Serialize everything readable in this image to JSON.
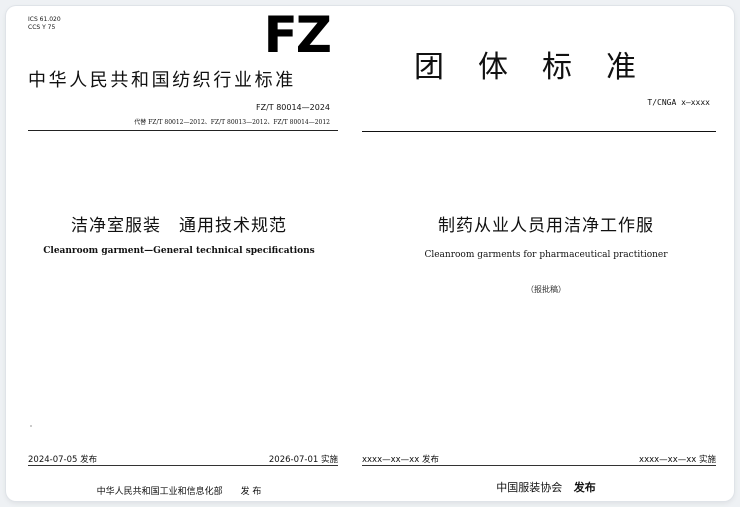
{
  "left_doc": {
    "ics": "ICS 61.020",
    "ccs": "CCS Y 75",
    "logo": "FZ",
    "standard_type": "中华人民共和国纺织行业标准",
    "number": "FZ/T 80014—2024",
    "replaces": "代替 FZ/T 80012—2012、FZ/T 80013—2012、FZ/T 80014—2012",
    "title_cn": "洁净室服装　通用技术规范",
    "title_en": "Cleanroom garment—General technical specifications",
    "publish_date": "2024-07-05 发布",
    "implement_date": "2026-07-01 实施",
    "issuer": "中华人民共和国工业和信息化部　　发 布"
  },
  "right_doc": {
    "standard_type": "团体标准",
    "number": "T/CNGA x—xxxx",
    "title_cn": "制药从业人员用洁净工作服",
    "title_en": "Cleanroom garments for pharmaceutical practitioner",
    "draft_note": "（报批稿）",
    "publish_date": "xxxx—xx—xx 发布",
    "implement_date": "xxxx—xx—xx 实施",
    "issuer_name": "中国服装协会",
    "issuer_action": "发布"
  },
  "colors": {
    "page_background": "#eef1f4",
    "paper": "#ffffff",
    "text": "#111111"
  }
}
